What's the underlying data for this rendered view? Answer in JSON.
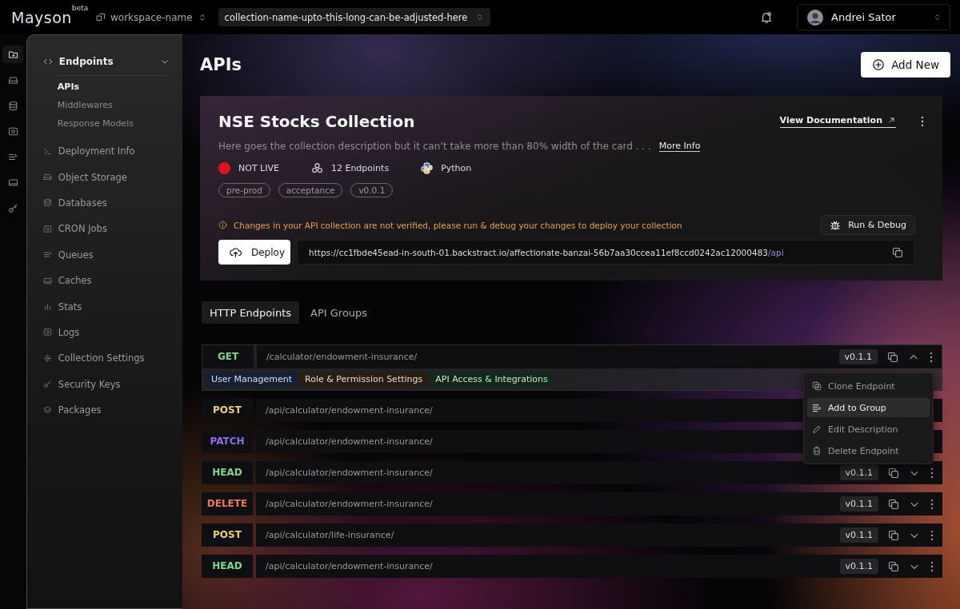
{
  "app": {
    "logo": "Mayson",
    "badge": "beta",
    "workspace": "workspace-name",
    "collection": "collection-name-upto-this-long-can-be-adjusted-here",
    "user": "Andrei Sator"
  },
  "rail": [
    {
      "kind": "folder",
      "selected": true
    },
    {
      "kind": "drive",
      "selected": false
    },
    {
      "kind": "database",
      "selected": false
    },
    {
      "kind": "cron",
      "selected": false
    },
    {
      "kind": "queue",
      "selected": false
    },
    {
      "kind": "cache",
      "selected": false
    },
    {
      "kind": "key",
      "selected": false
    }
  ],
  "sidebar": {
    "section": {
      "label": "Endpoints",
      "expanded": true,
      "children": [
        {
          "label": "APIs",
          "selected": true
        },
        {
          "label": "Middlewares",
          "selected": false
        },
        {
          "label": "Response Models",
          "selected": false
        }
      ]
    },
    "items": [
      {
        "label": "Deployment Info",
        "kind": "terminal"
      },
      {
        "label": "Object Storage",
        "kind": "drive"
      },
      {
        "label": "Databases",
        "kind": "database"
      },
      {
        "label": "CRON Jobs",
        "kind": "cron"
      },
      {
        "label": "Queues",
        "kind": "queue"
      },
      {
        "label": "Caches",
        "kind": "cache"
      },
      {
        "label": "Stats",
        "kind": "stats"
      },
      {
        "label": "Logs",
        "kind": "cron"
      },
      {
        "label": "Collection Settings",
        "kind": "gear"
      },
      {
        "label": "Security Keys",
        "kind": "key"
      },
      {
        "label": "Packages",
        "kind": "layers"
      }
    ]
  },
  "page": {
    "title": "APIs",
    "add_button": "Add New"
  },
  "collection": {
    "name": "NSE Stocks Collection",
    "description": "Here goes the collection description but it can’t take more than 80% width of the card . . .",
    "more_info": "More Info",
    "doc_link": "View Documentation",
    "status": {
      "label": "NOT LIVE",
      "live": false
    },
    "endpoints": "12 Endpoints",
    "language": "Python",
    "tags": [
      "pre-prod",
      "acceptance",
      "v0.0.1"
    ],
    "warning": "Changes in your API collection are not verified, please run & debug your changes to deploy your collection",
    "run_button": "Run & Debug",
    "deploy_button": "Deploy",
    "url": "https://cc1fbde45ead-in-south-01.backstract.io/affectionate-banzai-56b7aa30ccea11ef8ccd0242ac12000483",
    "url_suffix": "/api"
  },
  "tabs": [
    {
      "label": "HTTP Endpoints",
      "selected": true
    },
    {
      "label": "API Groups",
      "selected": false
    }
  ],
  "endpoints": [
    {
      "method": "GET",
      "color": "#7fd492",
      "path": "/calculator/endowment-insurance/",
      "version": "v0.1.1",
      "expanded": true,
      "groups": [
        {
          "label": "User Management",
          "color": "#12203a"
        },
        {
          "label": "Role & Permission Settings",
          "color": "#2a1c10"
        },
        {
          "label": "API Access & Integrations",
          "color": "#0f2a18"
        }
      ],
      "menu": [
        {
          "label": "Clone Endpoint",
          "kind": "clone",
          "selected": false
        },
        {
          "label": "Add to Group",
          "kind": "group",
          "selected": true
        },
        {
          "label": "Edit Description",
          "kind": "pencil",
          "selected": false
        },
        {
          "label": "Delete Endpoint",
          "kind": "trash",
          "selected": false
        }
      ]
    },
    {
      "method": "POST",
      "color": "#e8d07a",
      "path": "/api/calculator/endowment-insurance/"
    },
    {
      "method": "PATCH",
      "color": "#8f6cf0",
      "path": "/api/calculator/endowment-insurance/"
    },
    {
      "method": "HEAD",
      "color": "#7fd492",
      "path": "/api/calculator/endowment-insurance/",
      "version": "v0.1.1",
      "expanded": false
    },
    {
      "method": "DELETE",
      "color": "#f0755a",
      "path": "/api/calculator/endowment-insurance/",
      "version": "v0.1.1",
      "expanded": false
    },
    {
      "method": "POST",
      "color": "#e8d07a",
      "path": "/api/calculator/life-insurance/",
      "version": "v0.1.1",
      "expanded": false
    },
    {
      "method": "HEAD",
      "color": "#7fd492",
      "path": "/api/calculator/endowment-insurance/",
      "version": "v0.1.1",
      "expanded": false
    }
  ]
}
